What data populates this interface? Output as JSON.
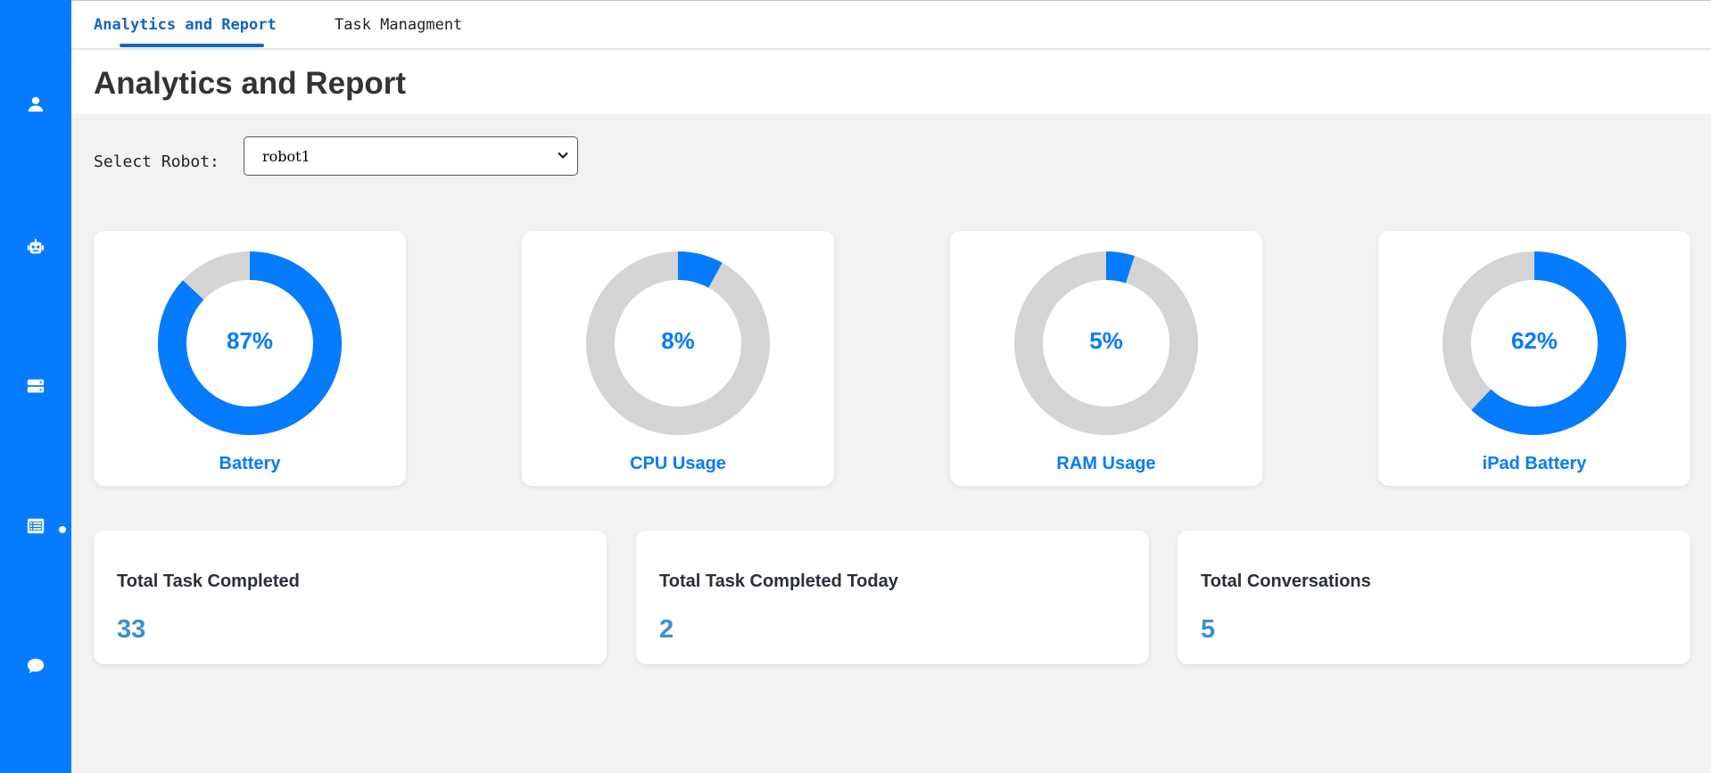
{
  "colors": {
    "accent": "#057bfe",
    "track": "#d4d4d4",
    "tab_active": "#1565c0",
    "stat_value": "#3a8fd6"
  },
  "sidebar": {
    "items": [
      {
        "icon": "user-icon"
      },
      {
        "icon": "robot-icon"
      },
      {
        "icon": "server-icon"
      },
      {
        "icon": "list-icon",
        "active": true
      },
      {
        "icon": "chat-icon"
      }
    ]
  },
  "tabs": [
    {
      "label": "Analytics and Report",
      "active": true
    },
    {
      "label": "Task Managment",
      "active": false
    }
  ],
  "page": {
    "title": "Analytics and Report"
  },
  "robot_select": {
    "label": "Select Robot:",
    "value": "robot1"
  },
  "gauges": [
    {
      "label": "Battery",
      "value": 87,
      "display": "87%"
    },
    {
      "label": "CPU Usage",
      "value": 8,
      "display": "8%"
    },
    {
      "label": "RAM Usage",
      "value": 5,
      "display": "5%"
    },
    {
      "label": "iPad Battery",
      "value": 62,
      "display": "62%"
    }
  ],
  "stats": [
    {
      "title": "Total Task Completed",
      "value": "33"
    },
    {
      "title": "Total Task Completed Today",
      "value": "2"
    },
    {
      "title": "Total Conversations",
      "value": "5"
    }
  ]
}
